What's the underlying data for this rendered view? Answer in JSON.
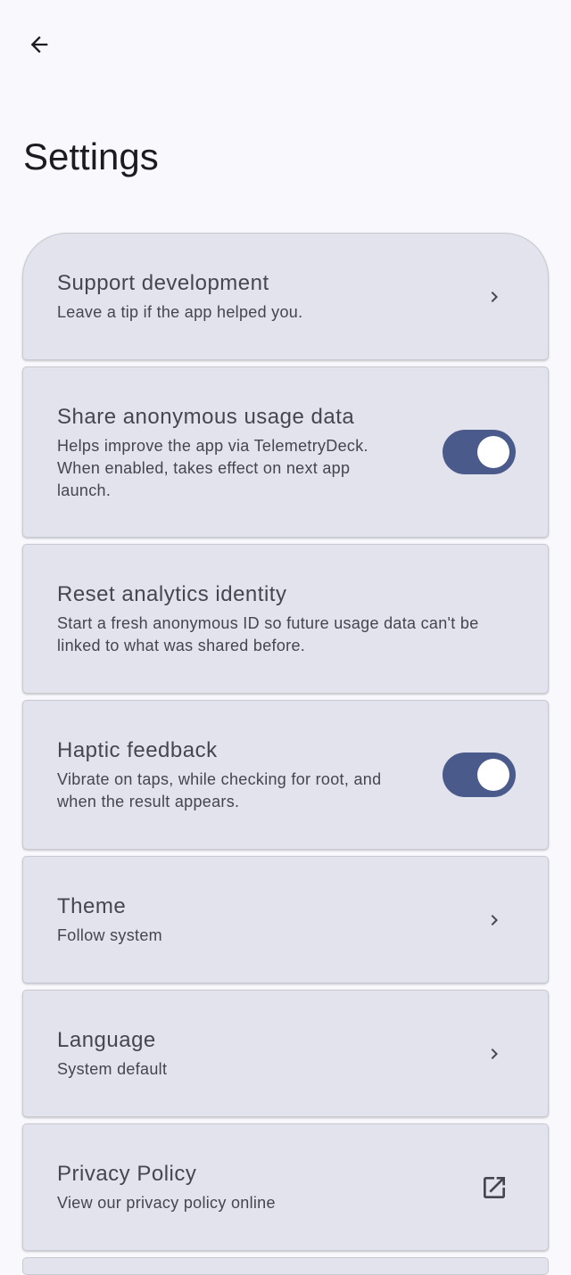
{
  "header": {
    "back_icon": "arrow-back-icon",
    "title": "Settings"
  },
  "settings": [
    {
      "title": "Support development",
      "subtitle": "Leave a tip if the app helped you.",
      "trailing": "chevron-right-icon"
    },
    {
      "title": "Share anonymous usage data",
      "subtitle": "Helps improve the app via TelemetryDeck. When enabled, takes effect on next app launch.",
      "trailing": "toggle",
      "enabled": true
    },
    {
      "title": "Reset analytics identity",
      "subtitle": "Start a fresh anonymous ID so future usage data can't be linked to what was shared before.",
      "trailing": "none"
    },
    {
      "title": "Haptic feedback",
      "subtitle": "Vibrate on taps, while checking for root, and when the result appears.",
      "trailing": "toggle",
      "enabled": true
    },
    {
      "title": "Theme",
      "subtitle": "Follow system",
      "trailing": "chevron-right-icon"
    },
    {
      "title": "Language",
      "subtitle": "System default",
      "trailing": "chevron-right-icon"
    },
    {
      "title": "Privacy Policy",
      "subtitle": "View our privacy policy online",
      "trailing": "open-in-new-icon"
    }
  ],
  "colors": {
    "background": "#f8f8fd",
    "card": "#e3e3ee",
    "toggle_track": "#4a5a8a",
    "toggle_thumb": "#ffffff"
  }
}
